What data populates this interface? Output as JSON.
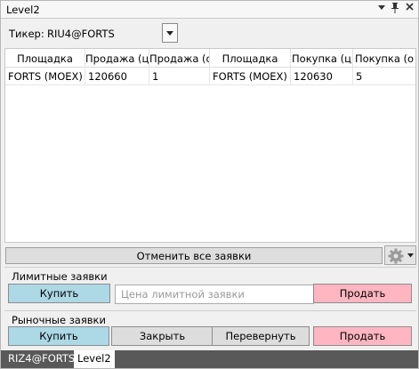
{
  "window": {
    "title": "Level2"
  },
  "ticker": {
    "label": "Тикер:",
    "value": "RIU4@FORTS"
  },
  "grid": {
    "columns": [
      "Площадка",
      "Продажа (ц",
      "Продажа (о",
      "Площадка",
      "Покупка (ц",
      "Покупка (о"
    ],
    "rows": [
      [
        "FORTS (MOEX)",
        "120660",
        "1",
        "FORTS (MOEX)",
        "120630",
        "5"
      ]
    ]
  },
  "cancel_all_label": "Отменить все заявки",
  "limit_group": {
    "title": "Лимитные заявки",
    "buy_label": "Купить",
    "price_placeholder": "Цена лимитной заявки",
    "sell_label": "Продать"
  },
  "market_group": {
    "title": "Рыночные заявки",
    "buy_label": "Купить",
    "close_label": "Закрыть",
    "reverse_label": "Перевернуть",
    "sell_label": "Продать"
  },
  "tabs": [
    {
      "label": "RIZ4@FORTS",
      "active": false
    },
    {
      "label": "Level2",
      "active": true
    }
  ],
  "colors": {
    "buy": "#add8e6",
    "sell": "#ffb6c1",
    "tabbar": "#595959"
  }
}
